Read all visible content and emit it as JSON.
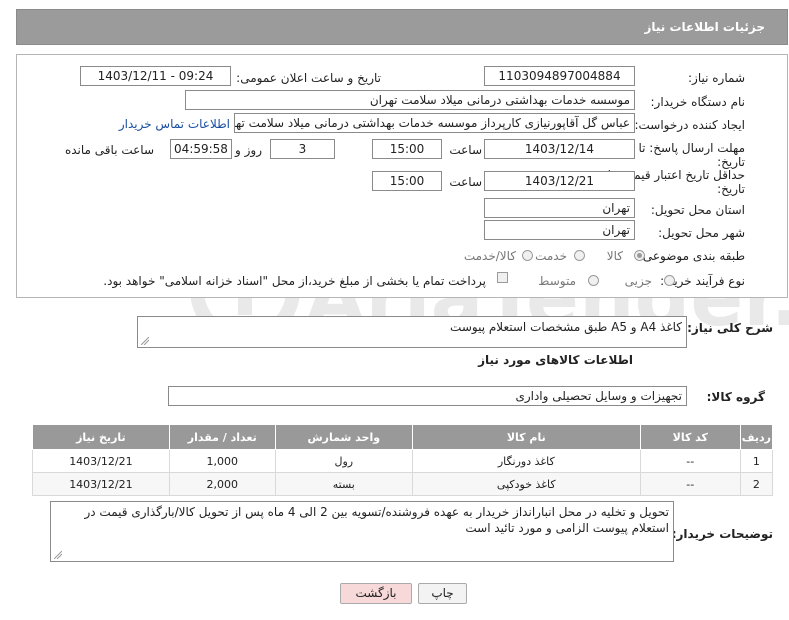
{
  "header": {
    "title": "جزئیات اطلاعات نیاز"
  },
  "form": {
    "need_number_label": "شماره نیاز:",
    "need_number_value": "1103094897004884",
    "announce_label": "تاریخ و ساعت اعلان عمومی:",
    "announce_value": "1403/12/11 - 09:24",
    "buyer_org_label": "نام دستگاه خریدار:",
    "buyer_org_value": "موسسه خدمات بهداشتی درمانی میلاد سلامت تهران",
    "requester_label": "ایجاد کننده درخواست:",
    "requester_value": "عباس گل آقاپورنیازی کارپرداز موسسه خدمات بهداشتی درمانی میلاد سلامت تهران",
    "contact_link": "اطلاعات تماس خریدار",
    "deadline_label_line1": "مهلت ارسال پاسخ: تا",
    "deadline_label_line2": "تاریخ:",
    "deadline_date": "1403/12/14",
    "time_label": "ساعت",
    "deadline_time": "15:00",
    "days_value": "3",
    "days_label": "روز و",
    "remaining_time": "04:59:58",
    "remaining_label": "ساعت باقی مانده",
    "validity_label_line1": "حداقل تاریخ اعتبار قیمت: تا",
    "validity_label_line2": "تاریخ:",
    "validity_date": "1403/12/21",
    "validity_time": "15:00",
    "province_label": "استان محل تحویل:",
    "province_value": "تهران",
    "city_label": "شهر محل تحویل:",
    "city_value": "تهران",
    "category_label": "طبقه بندی موضوعی:",
    "category_options": [
      "کالا",
      "خدمت",
      "کالا/خدمت"
    ],
    "category_selected": "کالا",
    "process_label": "نوع فرآیند خرید :",
    "process_options": [
      "جزیی",
      "متوسط"
    ],
    "payment_text": "پرداخت تمام یا بخشی از مبلغ خرید،از محل \"اسناد خزانه اسلامی\" خواهد بود."
  },
  "description": {
    "label": "شرح کلی نیاز:",
    "value": "کاغذ A4 و A5 طبق مشخصات استعلام پیوست"
  },
  "goods_section": {
    "title": "اطلاعات کالاهای مورد نیاز",
    "group_label": "گروه کالا:",
    "group_value": "تجهیزات و وسایل تحصیلی واداری"
  },
  "table": {
    "headers": [
      "ردیف",
      "کد کالا",
      "نام کالا",
      "واحد شمارش",
      "تعداد / مقدار",
      "تاریخ نیاز"
    ],
    "rows": [
      {
        "index": "1",
        "code": "--",
        "name": "کاغذ دورنگار",
        "unit": "رول",
        "qty": "1,000",
        "date": "1403/12/21"
      },
      {
        "index": "2",
        "code": "--",
        "name": "کاغذ خودکپی",
        "unit": "بسته",
        "qty": "2,000",
        "date": "1403/12/21"
      }
    ]
  },
  "buyer_notes": {
    "label": "توضیحات خریدار:",
    "value": "تحویل و تخلیه در محل انبارانداز خریدار به عهده فروشنده/تسویه بین 2 الی 4 ماه پس از تحویل کالا/بارگذاری قیمت در استعلام پیوست الزامی و مورد تائید است"
  },
  "buttons": {
    "print": "چاپ",
    "back": "بازگشت"
  },
  "watermark": {
    "text": "AriaTender.neT"
  },
  "colors": {
    "header_bg": "#9b9b9b",
    "table_header_bg": "#999999",
    "link": "#1a4fa0",
    "back_button_bg": "#f7d9d9"
  }
}
